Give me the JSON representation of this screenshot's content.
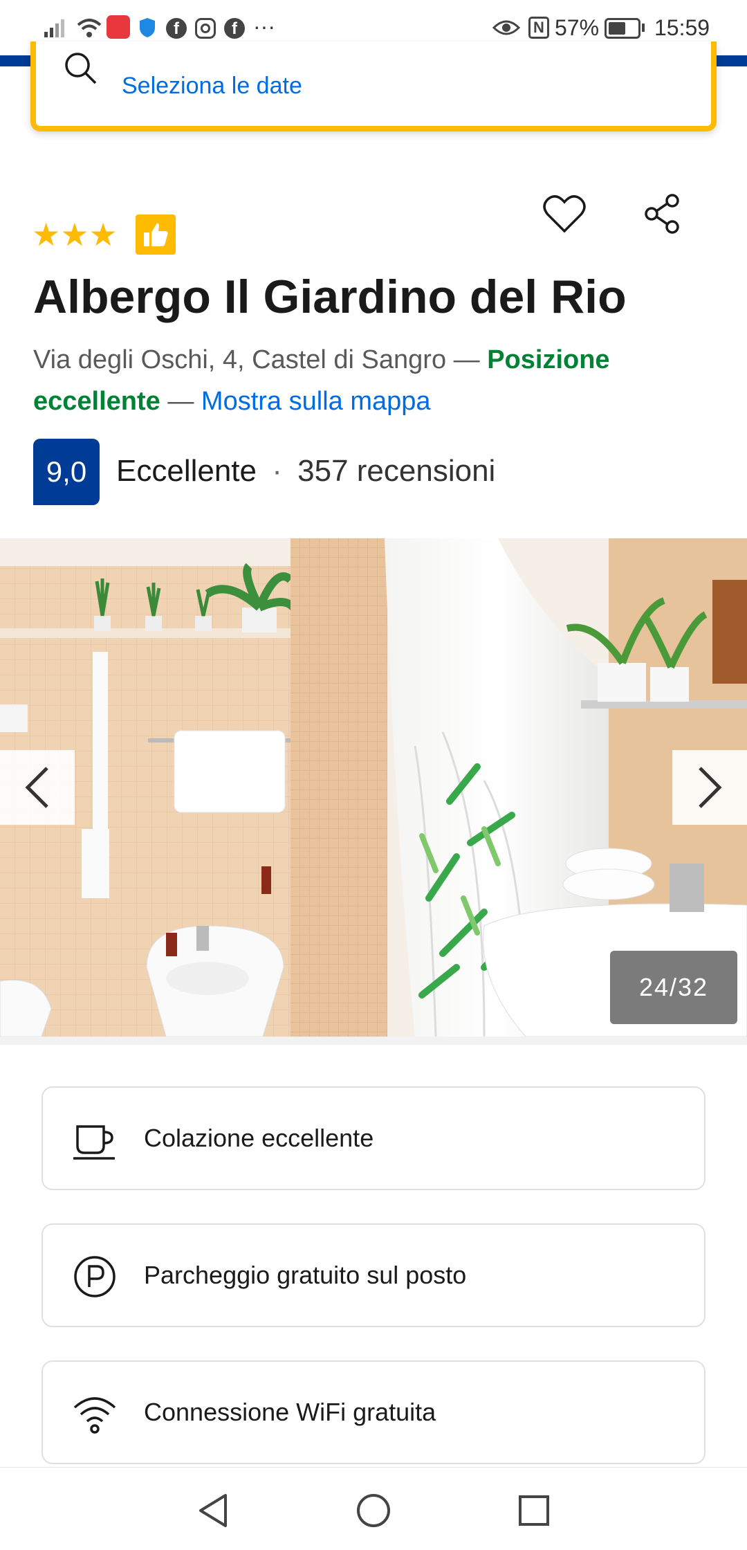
{
  "status_bar": {
    "battery": "57%",
    "time": "15:59",
    "more": "···"
  },
  "search": {
    "date_link": "Seleziona le date"
  },
  "hotel": {
    "stars": 3,
    "name": "Albergo Il Giardino del Rio",
    "address": "Via degli Oschi, 4, Castel di Sangro",
    "separator": "—",
    "location_rating": "Posizione eccellente",
    "map_link": "Mostra sulla mappa",
    "score": "9,0",
    "score_label": "Eccellente",
    "dot": "·",
    "reviews": "357 recensioni"
  },
  "photo": {
    "counter": "24/32"
  },
  "facilities": [
    {
      "icon": "coffee-cup-icon",
      "label": "Colazione eccellente"
    },
    {
      "icon": "parking-icon",
      "label": "Parcheggio gratuito sul posto"
    },
    {
      "icon": "wifi-icon",
      "label": "Connessione WiFi gratuita"
    }
  ],
  "colors": {
    "brand_blue": "#003b95",
    "accent_yellow": "#febb02",
    "link_blue": "#006ce4",
    "positive_green": "#008234"
  }
}
